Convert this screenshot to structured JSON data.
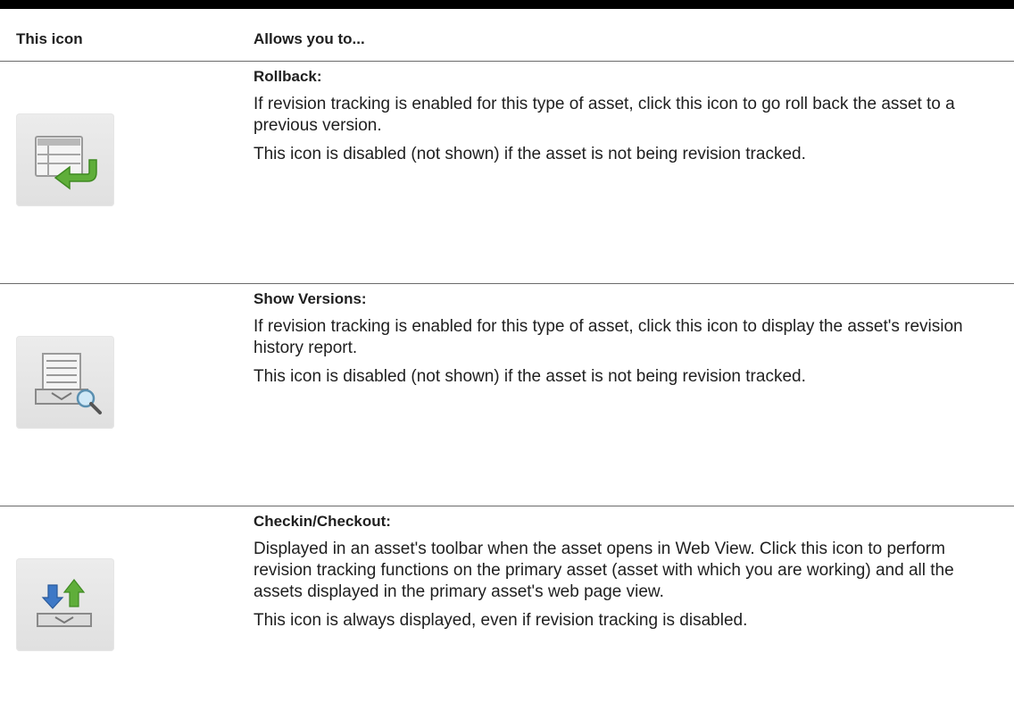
{
  "header": {
    "col_icon": "This icon",
    "col_desc": "Allows you to..."
  },
  "rows": [
    {
      "icon": "rollback-icon",
      "title": "Rollback:",
      "paragraphs": [
        "If revision tracking is enabled for this type of asset, click this icon to go roll back the asset to a previous version.",
        "This icon is disabled (not shown) if the asset is not being revision tracked."
      ]
    },
    {
      "icon": "show-versions-icon",
      "title": "Show Versions:",
      "paragraphs": [
        "If revision tracking is enabled for this type of asset, click this icon to display the asset's revision history report.",
        "This icon is disabled (not shown) if the asset is not being revision tracked."
      ]
    },
    {
      "icon": "checkin-checkout-icon",
      "title": "Checkin/Checkout:",
      "paragraphs": [
        "Displayed in an asset's toolbar when the asset opens in Web View. Click this icon to perform revision tracking functions on the primary asset (asset with which you are working) and all the assets displayed in the primary asset's web page view.",
        "This icon is always displayed, even if revision tracking is disabled."
      ]
    }
  ]
}
